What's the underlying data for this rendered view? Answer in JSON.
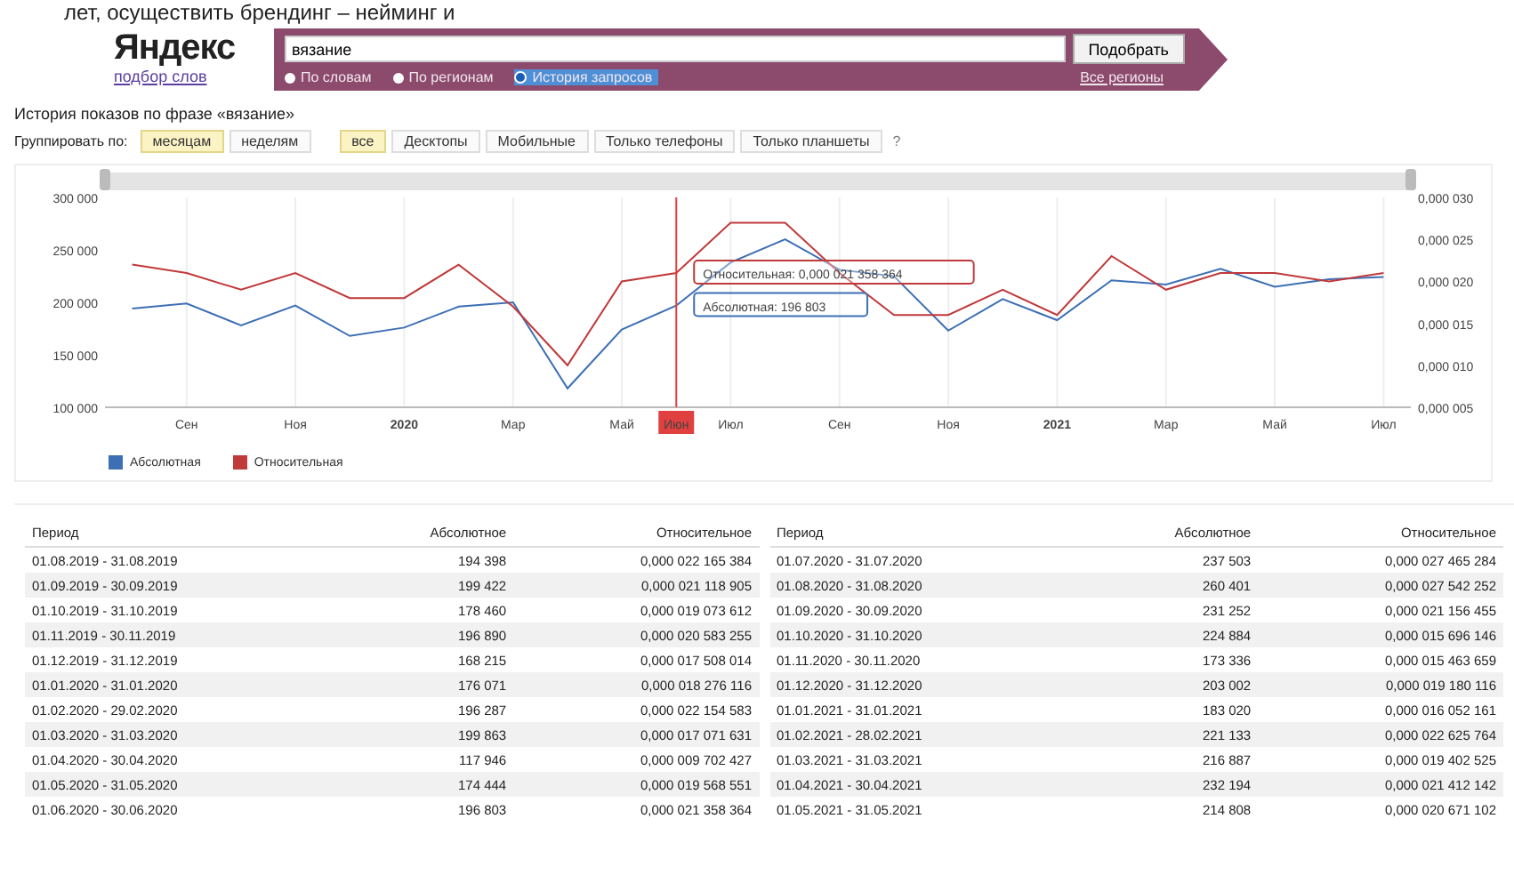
{
  "top_text": "лет, осуществить брендинг – нейминг и",
  "logo": {
    "name": "Яндекс",
    "subtitle": "подбор слов"
  },
  "search": {
    "value": "вязание",
    "button": "Подобрать",
    "regions_link": "Все регионы",
    "modes": [
      {
        "label": "По словам",
        "selected": false
      },
      {
        "label": "По регионам",
        "selected": false
      },
      {
        "label": "История запросов",
        "selected": true
      }
    ]
  },
  "history_title": "История показов по фразе «вязание»",
  "group_by": {
    "label": "Группировать по:",
    "options": [
      {
        "label": "месяцам",
        "selected": true
      },
      {
        "label": "неделям",
        "selected": false
      }
    ]
  },
  "devices": [
    {
      "label": "все",
      "selected": true
    },
    {
      "label": "Десктопы",
      "selected": false
    },
    {
      "label": "Мобильные",
      "selected": false
    },
    {
      "label": "Только телефоны",
      "selected": false
    },
    {
      "label": "Только планшеты",
      "selected": false
    }
  ],
  "devices_help": "?",
  "chart": {
    "chart_data": {
      "type": "line",
      "grid": true,
      "categories": [
        null,
        "Сен",
        null,
        "Ноя",
        null,
        "2020",
        null,
        "Мар",
        null,
        "Май",
        "Июн",
        "Июл",
        null,
        "Сен",
        null,
        "Ноя",
        null,
        "2021",
        null,
        "Мар",
        null,
        "Май",
        null,
        "Июл"
      ],
      "ylim": [
        100000,
        300000
      ],
      "y2lim": [
        5e-06,
        3e-05
      ],
      "yticks": [
        {
          "value": 300000,
          "label": "300 000"
        },
        {
          "value": 250000,
          "label": "250 000"
        },
        {
          "value": 200000,
          "label": "200 000"
        },
        {
          "value": 150000,
          "label": "150 000"
        },
        {
          "value": 100000,
          "label": "100 000"
        }
      ],
      "y2ticks": [
        {
          "value": 3e-05,
          "label": "0,000 030"
        },
        {
          "value": 2.5e-05,
          "label": "0,000 025"
        },
        {
          "value": 2e-05,
          "label": "0,000 020"
        },
        {
          "value": 1.5e-05,
          "label": "0,000 015"
        },
        {
          "value": 1e-05,
          "label": "0,000 010"
        },
        {
          "value": 5e-06,
          "label": "0,000 005"
        }
      ],
      "series": [
        {
          "name": "Абсолютная",
          "color": "#3d6fb4",
          "values": [
            194000,
            199000,
            178000,
            197000,
            168000,
            176000,
            196000,
            200000,
            118000,
            174000,
            197000,
            238000,
            260000,
            231000,
            225000,
            173000,
            203000,
            183000,
            221000,
            217000,
            232000,
            215000,
            222000,
            224000
          ]
        },
        {
          "name": "Относительная",
          "color": "#c0393b",
          "axis": "y2",
          "values": [
            2.2e-05,
            2.1e-05,
            1.9e-05,
            2.1e-05,
            1.8e-05,
            1.8e-05,
            2.2e-05,
            1.7e-05,
            1e-05,
            2e-05,
            2.1e-05,
            2.7e-05,
            2.7e-05,
            2.1e-05,
            1.6e-05,
            1.6e-05,
            1.9e-05,
            1.6e-05,
            2.3e-05,
            1.9e-05,
            2.1e-05,
            2.1e-05,
            2e-05,
            2.1e-05
          ]
        }
      ],
      "ref_lines": [
        {
          "axis": "x",
          "value": "Июн",
          "color": "#e04040"
        }
      ]
    },
    "tooltips": [
      {
        "text": "Относительная: 0,000 021 358 364",
        "color": "#c0393b"
      },
      {
        "text": "Абсолютная: 196 803",
        "color": "#3d6fb4"
      }
    ]
  },
  "tables": [
    {
      "columns": [
        "Период",
        "Абсолютное",
        "Относительное"
      ],
      "rows": [
        [
          "01.08.2019 - 31.08.2019",
          "194 398",
          "0,000 022 165 384"
        ],
        [
          "01.09.2019 - 30.09.2019",
          "199 422",
          "0,000 021 118 905"
        ],
        [
          "01.10.2019 - 31.10.2019",
          "178 460",
          "0,000 019 073 612"
        ],
        [
          "01.11.2019 - 30.11.2019",
          "196 890",
          "0,000 020 583 255"
        ],
        [
          "01.12.2019 - 31.12.2019",
          "168 215",
          "0,000 017 508 014"
        ],
        [
          "01.01.2020 - 31.01.2020",
          "176 071",
          "0,000 018 276 116"
        ],
        [
          "01.02.2020 - 29.02.2020",
          "196 287",
          "0,000 022 154 583"
        ],
        [
          "01.03.2020 - 31.03.2020",
          "199 863",
          "0,000 017 071 631"
        ],
        [
          "01.04.2020 - 30.04.2020",
          "117 946",
          "0,000 009 702 427"
        ],
        [
          "01.05.2020 - 31.05.2020",
          "174 444",
          "0,000 019 568 551"
        ],
        [
          "01.06.2020 - 30.06.2020",
          "196 803",
          "0,000 021 358 364"
        ]
      ]
    },
    {
      "columns": [
        "Период",
        "Абсолютное",
        "Относительное"
      ],
      "rows": [
        [
          "01.07.2020 - 31.07.2020",
          "237 503",
          "0,000 027 465 284"
        ],
        [
          "01.08.2020 - 31.08.2020",
          "260 401",
          "0,000 027 542 252"
        ],
        [
          "01.09.2020 - 30.09.2020",
          "231 252",
          "0,000 021 156 455"
        ],
        [
          "01.10.2020 - 31.10.2020",
          "224 884",
          "0,000 015 696 146"
        ],
        [
          "01.11.2020 - 30.11.2020",
          "173 336",
          "0,000 015 463 659"
        ],
        [
          "01.12.2020 - 31.12.2020",
          "203 002",
          "0,000 019 180 116"
        ],
        [
          "01.01.2021 - 31.01.2021",
          "183 020",
          "0,000 016 052 161"
        ],
        [
          "01.02.2021 - 28.02.2021",
          "221 133",
          "0,000 022 625 764"
        ],
        [
          "01.03.2021 - 31.03.2021",
          "216 887",
          "0,000 019 402 525"
        ],
        [
          "01.04.2021 - 30.04.2021",
          "232 194",
          "0,000 021 412 142"
        ],
        [
          "01.05.2021 - 31.05.2021",
          "214 808",
          "0,000 020 671 102"
        ]
      ]
    }
  ]
}
